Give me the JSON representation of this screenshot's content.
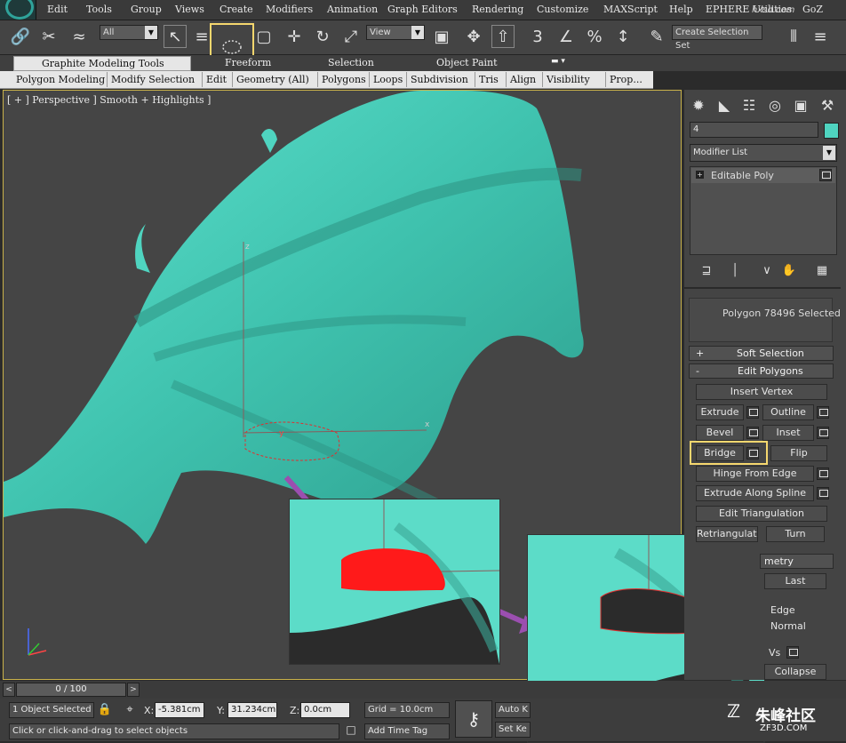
{
  "menubar": {
    "items": [
      "Edit",
      "Tools",
      "Group",
      "Views",
      "Create",
      "Modifiers",
      "Animation",
      "Graph Editors",
      "Rendering",
      "Customize",
      "MAXScript",
      "Help",
      "EPHERE Utilities",
      "GoZ"
    ]
  },
  "toolbar": {
    "filter_value": "All",
    "refcoord_value": "View",
    "named_selection_placeholder": "Create Selection Set",
    "icons": [
      "link-icon",
      "unlink-icon",
      "bind-space-warp-icon",
      "select-object-icon",
      "select-by-name-icon",
      "lasso-selection-region-icon",
      "window-crossing-icon",
      "move-icon",
      "rotate-icon",
      "scale-icon",
      "pivot-icon",
      "select-manipulate-icon",
      "snap-3d-icon",
      "angle-snap-icon",
      "percent-snap-icon",
      "spinner-snap-icon",
      "edit-named-selection-icon",
      "mirror-icon",
      "align-icon"
    ]
  },
  "ribbon": {
    "tabs": [
      "Graphite Modeling Tools",
      "Freeform",
      "Selection",
      "Object Paint"
    ],
    "subtabs": [
      "Polygon Modeling",
      "Modify Selection",
      "Edit",
      "Geometry (All)",
      "Polygons",
      "Loops",
      "Subdivision",
      "Tris",
      "Align",
      "Visibility",
      "Prop..."
    ]
  },
  "viewport": {
    "label": "[ + ] Perspective ] Smooth + Highlights ]",
    "axis_labels": {
      "x": "x",
      "y": "y",
      "z": "z"
    }
  },
  "command_panel": {
    "object_name": "4",
    "object_color": "#4fd4c0",
    "modifier_list_label": "Modifier List",
    "stack_item": "Editable Poly",
    "selection_info": "Polygon 78496 Selected",
    "rollouts": {
      "soft_selection": "Soft Selection",
      "edit_polygons": "Edit Polygons",
      "edit_geometry_partial": "metry"
    },
    "rollout_signs": {
      "soft_selection": "+",
      "edit_polygons": "-"
    },
    "buttons": {
      "insert_vertex": "Insert Vertex",
      "extrude": "Extrude",
      "outline": "Outline",
      "bevel": "Bevel",
      "inset": "Inset",
      "bridge": "Bridge",
      "flip": "Flip",
      "hinge_from_edge": "Hinge From Edge",
      "extrude_along_spline": "Extrude Along Spline",
      "edit_triangulation": "Edit Triangulation",
      "retriangulate": "Retriangulate",
      "turn": "Turn",
      "last": "Last",
      "edge": "Edge",
      "normal": "Normal",
      "vs": "Vs",
      "collapse": "Collapse"
    }
  },
  "timeline": {
    "frame_label": "0 / 100"
  },
  "statusbar": {
    "objects_selected": "1 Object Selected",
    "x_label": "X:",
    "x_value": "-5.381cm",
    "y_label": "Y:",
    "y_value": "31.234cm",
    "z_label": "Z:",
    "z_value": "0.0cm",
    "grid": "Grid = 10.0cm",
    "auto_key": "Auto K",
    "set_key": "Set Ke",
    "prompt": "Click or click-and-drag to select objects",
    "add_time_tag": "Add Time Tag"
  },
  "watermarks": {
    "top": "hxsd.com",
    "bottom_logo": "朱峰社区",
    "bottom_url": "ZF3D.COM"
  },
  "colors": {
    "wing": "#4fd4c0",
    "selection": "#ff1a1a",
    "highlight": "#f5d76e",
    "arrow": "#9b4fb0"
  }
}
